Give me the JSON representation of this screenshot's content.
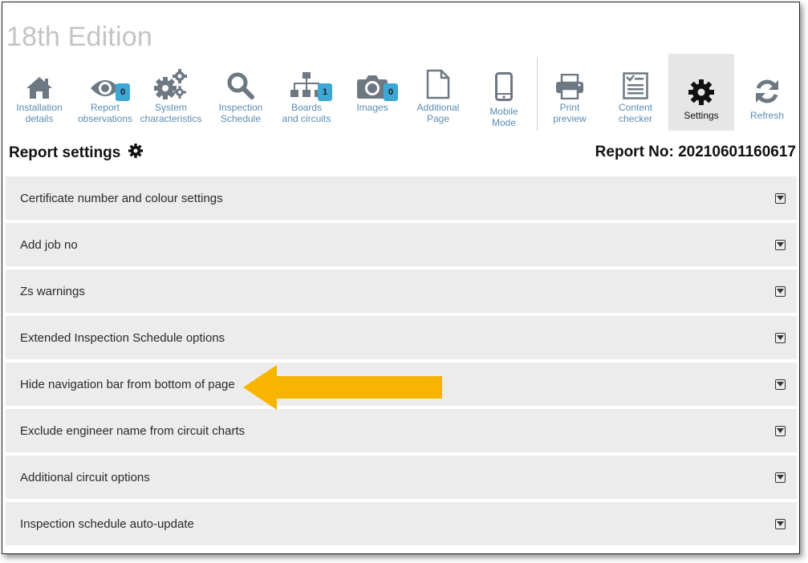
{
  "edition_title": "18th Edition",
  "toolbar": {
    "items": [
      {
        "label_1": "Installation",
        "label_2": "details",
        "icon": "home-icon"
      },
      {
        "label_1": "Report",
        "label_2": "observations",
        "icon": "eye-icon",
        "badge": "0"
      },
      {
        "label_1": "System",
        "label_2": "characteristics",
        "icon": "gears-icon"
      },
      {
        "label_1": "Inspection",
        "label_2": "Schedule",
        "icon": "magnifier-icon"
      },
      {
        "label_1": "Boards",
        "label_2": "and circuits",
        "icon": "sitemap-icon",
        "badge": "1"
      },
      {
        "label_1": "Images",
        "label_2": "",
        "icon": "camera-icon",
        "badge": "0"
      },
      {
        "label_1": "Additional",
        "label_2": "Page",
        "icon": "page-icon"
      },
      {
        "label_1": "Mobile",
        "label_2": "Mode",
        "icon": "mobile-icon"
      },
      {
        "label_1": "Print",
        "label_2": "preview",
        "icon": "printer-icon"
      },
      {
        "label_1": "Content",
        "label_2": "checker",
        "icon": "checklist-icon"
      },
      {
        "label_1": "Settings",
        "label_2": "",
        "icon": "gear-icon",
        "active": true
      },
      {
        "label_1": "Refresh",
        "label_2": "",
        "icon": "refresh-icon"
      }
    ]
  },
  "header": {
    "title": "Report settings",
    "report_no": "Report No: 20210601160617"
  },
  "panels": [
    "Certificate number and colour settings",
    "Add job no",
    "Zs warnings",
    "Extended Inspection Schedule options",
    "Hide navigation bar from bottom of page",
    "Exclude engineer name from circuit charts",
    "Additional circuit options",
    "Inspection schedule auto-update"
  ],
  "colors": {
    "toolbar_text": "#5b8cb3",
    "icon_grey": "#6d7883",
    "badge": "#3fa7d6",
    "panel_bg": "#ececec",
    "arrow": "#f7b500"
  }
}
